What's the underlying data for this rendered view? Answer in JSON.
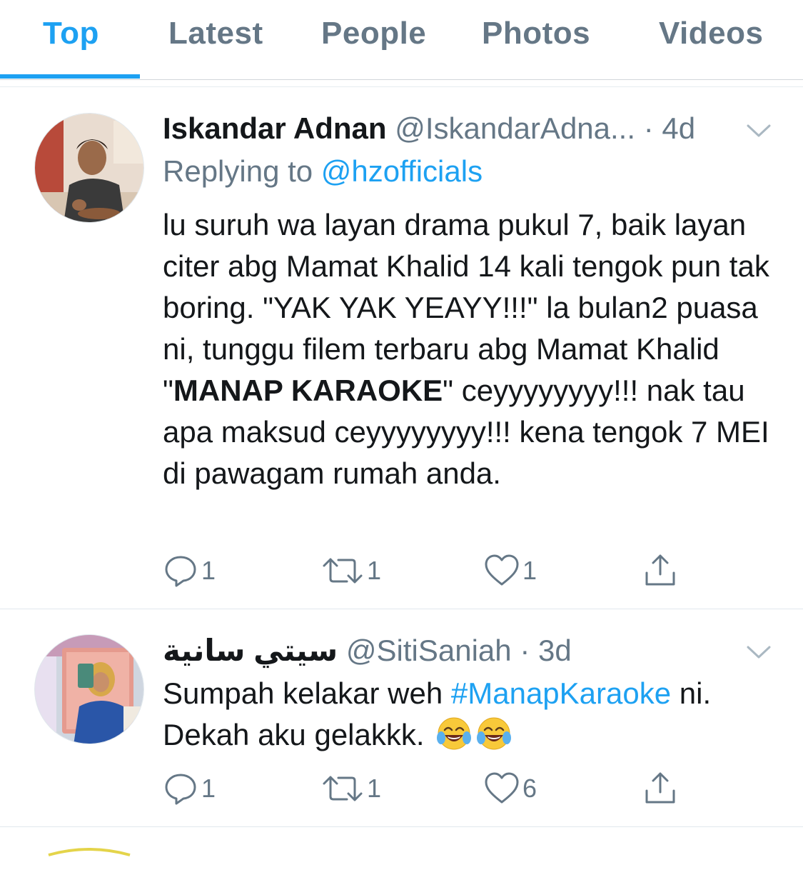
{
  "tabs": [
    {
      "label": "Top",
      "active": true
    },
    {
      "label": "Latest",
      "active": false
    },
    {
      "label": "People",
      "active": false
    },
    {
      "label": "Photos",
      "active": false
    },
    {
      "label": "Videos",
      "active": false
    }
  ],
  "colors": {
    "accent": "#1da1f2",
    "muted": "#657786",
    "text": "#14171a",
    "divider": "#e1e8ed"
  },
  "tweets": [
    {
      "display_name": "Iskandar Adnan",
      "handle": "@IskandarAdna...",
      "time": "· 4d",
      "replying_prefix": "Replying to ",
      "replying_handle": "@hzofficials",
      "body": {
        "p1": "lu suruh wa layan drama pukul 7, baik layan citer abg Mamat Khalid 14 kali tengok pun tak boring. \"YAK YAK YEAYY!!!\" la bulan2 puasa ni, tunggu filem terbaru abg Mamat Khalid \"",
        "bold": "MANAP KARAOKE",
        "p2": "\" ceyyyyyyyy!!! nak tau apa maksud ceyyyyyyyy!!! kena tengok 7 MEI di pawagam rumah anda."
      },
      "reply_count": "1",
      "retweet_count": "1",
      "like_count": "1",
      "avatar_icon": "profile-photo-man"
    },
    {
      "display_name": "سيتي سانية",
      "handle": "@SitiSaniah",
      "time": "· 3d",
      "body": {
        "p1": "Sumpah kelakar weh ",
        "hashtag": "#ManapKaraoke",
        "p2": " ni. Dekah aku gelakkk. "
      },
      "emojis": [
        "face-with-tears-of-joy",
        "face-with-tears-of-joy"
      ],
      "reply_count": "1",
      "retweet_count": "1",
      "like_count": "6",
      "avatar_icon": "profile-photo-woman-mirror-selfie"
    }
  ]
}
